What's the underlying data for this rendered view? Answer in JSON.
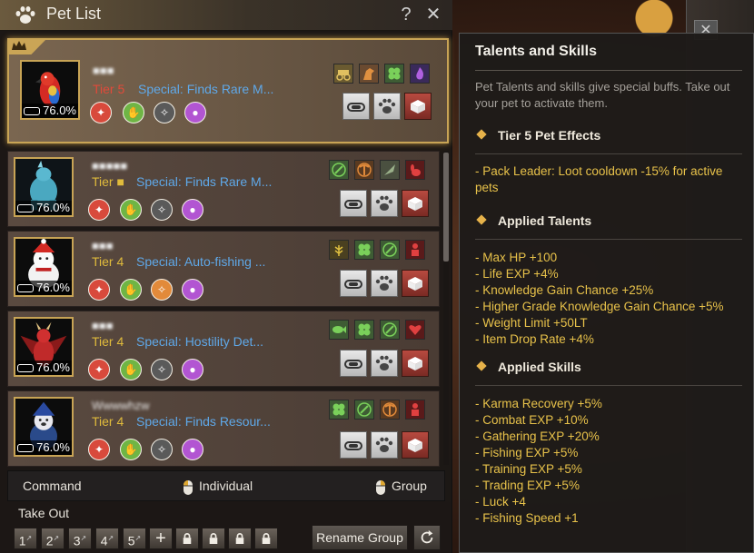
{
  "window": {
    "title": "Pet List",
    "help_label": "?",
    "close_label": "✕"
  },
  "pets": [
    {
      "name": "■■■",
      "tier": "Tier 5",
      "special": "Special: Finds Rare M...",
      "hunger": "76.0%",
      "portrait": "red-parrot",
      "talents": [
        "carriage-icon",
        "horse-icon",
        "clover-icon",
        "purple-flame-icon"
      ],
      "skills": [
        "red",
        "green",
        "gray",
        "purple"
      ]
    },
    {
      "name": "■■■■■",
      "tier": "Tier ■",
      "special": "Special: Finds Rare M...",
      "hunger": "76.0%",
      "portrait": "ice-dragon",
      "talents": [
        "sickle-icon",
        "pickaxe-icon",
        "feather-icon",
        "rabbit-icon"
      ],
      "skills": [
        "red",
        "green",
        "gray",
        "purple"
      ]
    },
    {
      "name": "■■■",
      "tier": "Tier 4",
      "special": "Special: Auto-fishing ...",
      "hunger": "76.0%",
      "portrait": "polar-bear",
      "talents": [
        "wheat-icon",
        "clover-icon",
        "sickle-icon",
        "person-icon"
      ],
      "skills": [
        "red",
        "green",
        "orange",
        "purple"
      ]
    },
    {
      "name": "■■■",
      "tier": "Tier 4",
      "special": "Special: Hostility Det...",
      "hunger": "76.0%",
      "portrait": "red-dragon",
      "talents": [
        "fish-icon",
        "clover-icon",
        "sickle-icon",
        "heart-icon"
      ],
      "skills": [
        "red",
        "green",
        "gray",
        "purple"
      ]
    },
    {
      "name": "Wwwwhzw",
      "tier": "Tier 4",
      "special": "Special: Finds Resour...",
      "hunger": "76.0%",
      "portrait": "blue-dog",
      "talents": [
        "clover-icon",
        "sickle-icon",
        "pickaxe-icon",
        "person-icon"
      ],
      "skills": [
        "red",
        "green",
        "gray",
        "purple"
      ]
    }
  ],
  "bottom": {
    "command_label": "Command",
    "individual_label": "Individual",
    "group_label": "Group",
    "takeout_label": "Take Out",
    "slots": [
      "1",
      "2",
      "3",
      "4",
      "5"
    ],
    "rename_group_label": "Rename Group"
  },
  "tooltip": {
    "title": "Talents and Skills",
    "description": "Pet Talents and skills give special buffs. Take out your pet to activate them.",
    "tier_section": "Tier 5 Pet Effects",
    "tier_effect": "- Pack Leader: Loot cooldown -15% for active pets",
    "talents_section": "Applied Talents",
    "talents": [
      "- Max HP +100",
      "- Life EXP +4%",
      "- Knowledge Gain Chance +25%",
      "- Higher Grade Knowledge Gain Chance +5%",
      "- Weight Limit +50LT",
      "- Item Drop Rate +4%"
    ],
    "skills_section": "Applied Skills",
    "skills": [
      "- Karma Recovery +5%",
      "- Combat EXP +10%",
      "- Gathering EXP +20%",
      "- Fishing EXP +5%",
      "- Training EXP +5%",
      "- Trading EXP +5%",
      "- Luck +4",
      "- Fishing Speed +1"
    ]
  },
  "colors": {
    "accent_gold": "#c8a455",
    "tier5_red": "#e04a3a",
    "tier4_gold": "#e0bb3c",
    "special_blue": "#5fa8e8",
    "tooltip_yellow": "#e8c24a"
  }
}
